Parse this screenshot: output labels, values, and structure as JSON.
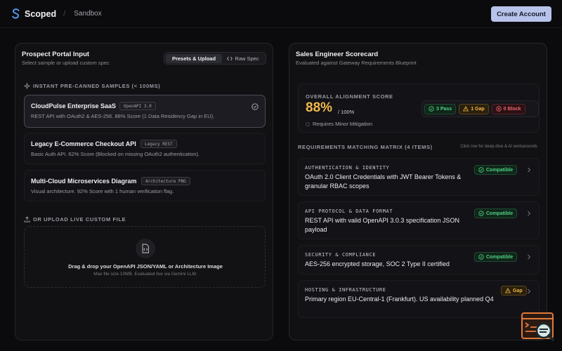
{
  "header": {
    "brand": "Scoped",
    "separator": "/",
    "breadcrumb": "Sandbox",
    "create_button": "Create Account"
  },
  "left_panel": {
    "title": "Prospect Portal Input",
    "subtitle": "Select sample or upload custom spec",
    "tabs": [
      {
        "label": "Presets & Upload",
        "active": true
      },
      {
        "label": "Raw Spec",
        "active": false
      }
    ],
    "samples_label": "INSTANT PRE-CANNED SAMPLES (< 100MS)",
    "samples": [
      {
        "title": "CloudPulse Enterprise SaaS",
        "tag": "OpenAPI 3.0",
        "description": "REST API with OAuth2 & AES-256. 88% Score (1 Data Residency Gap in EU).",
        "selected": true
      },
      {
        "title": "Legacy E-Commerce Checkout API",
        "tag": "Legacy REST",
        "description": "Basic Auth API. 62% Score (Blocked on missing OAuth2 authentication).",
        "selected": false
      },
      {
        "title": "Multi-Cloud Microservices Diagram",
        "tag": "Architecture PNG",
        "description": "Visual architecture. 92% Score with 1 human verification flag.",
        "selected": false
      }
    ],
    "upload_label": "OR UPLOAD LIVE CUSTOM FILE",
    "dropzone": {
      "title": "Drag & drop your OpenAPI JSON/YAML or Architecture Image",
      "subtitle": "Max file size 10MB. Evaluated live via Gemini LLM."
    }
  },
  "right_panel": {
    "title": "Sales Engineer Scorecard",
    "subtitle": "Evaluated against Gateway Requirements Blueprint",
    "score": {
      "label": "OVERALL ALIGNMENT SCORE",
      "value": "88%",
      "of": "/ 100%",
      "note": "Requires Minor Mitigation",
      "badges": {
        "pass": "3 Pass",
        "gap": "1 Gap",
        "block": "0 Block"
      }
    },
    "matrix": {
      "label": "REQUIREMENTS MATCHING MATRIX (4 ITEMS)",
      "hint": "Click row for deep-dive & AI workarounds",
      "rows": [
        {
          "category": "AUTHENTICATION & IDENTITY",
          "text": "OAuth 2.0 Client Credentials with JWT Bearer Tokens & granular RBAC scopes",
          "status": "Compatible"
        },
        {
          "category": "API PROTOCOL & DATA FORMAT",
          "text": "REST API with valid OpenAPI 3.0.3 specification JSON payload",
          "status": "Compatible"
        },
        {
          "category": "SECURITY & COMPLIANCE",
          "text": "AES-256 encrypted storage, SOC 2 Type II certified",
          "status": "Compatible"
        },
        {
          "category": "HOSTING & INFRASTRUCTURE",
          "text": "Primary region EU-Central-1 (Frankfurt). US availability planned Q4",
          "status": "Gap"
        }
      ]
    }
  },
  "colors": {
    "accent": "#b7c3ea",
    "score": "#f2b94a",
    "pass": "#4fcf82",
    "gap": "#f0b548",
    "block": "#f0636d"
  }
}
